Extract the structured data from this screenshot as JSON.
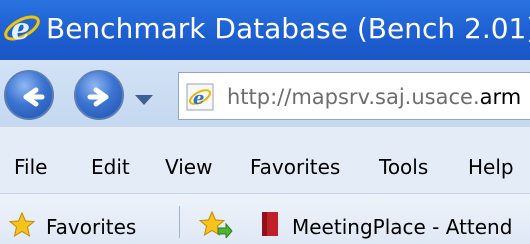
{
  "window": {
    "title": "Benchmark Database (Bench 2.01) -",
    "title_bar_color": "#1d5fd1"
  },
  "navigation": {
    "back_icon": "back-arrow-icon",
    "forward_icon": "forward-arrow-icon",
    "history_icon": "chevron-down-icon",
    "address_prefix": "http://mapsrv.saj.usace.",
    "address_suffix": "arm"
  },
  "menu": {
    "items": [
      "File",
      "Edit",
      "View",
      "Favorites",
      "Tools",
      "Help"
    ]
  },
  "favorites_bar": {
    "favorites_label": "Favorites",
    "site_label": "MeetingPlace - Attend"
  }
}
